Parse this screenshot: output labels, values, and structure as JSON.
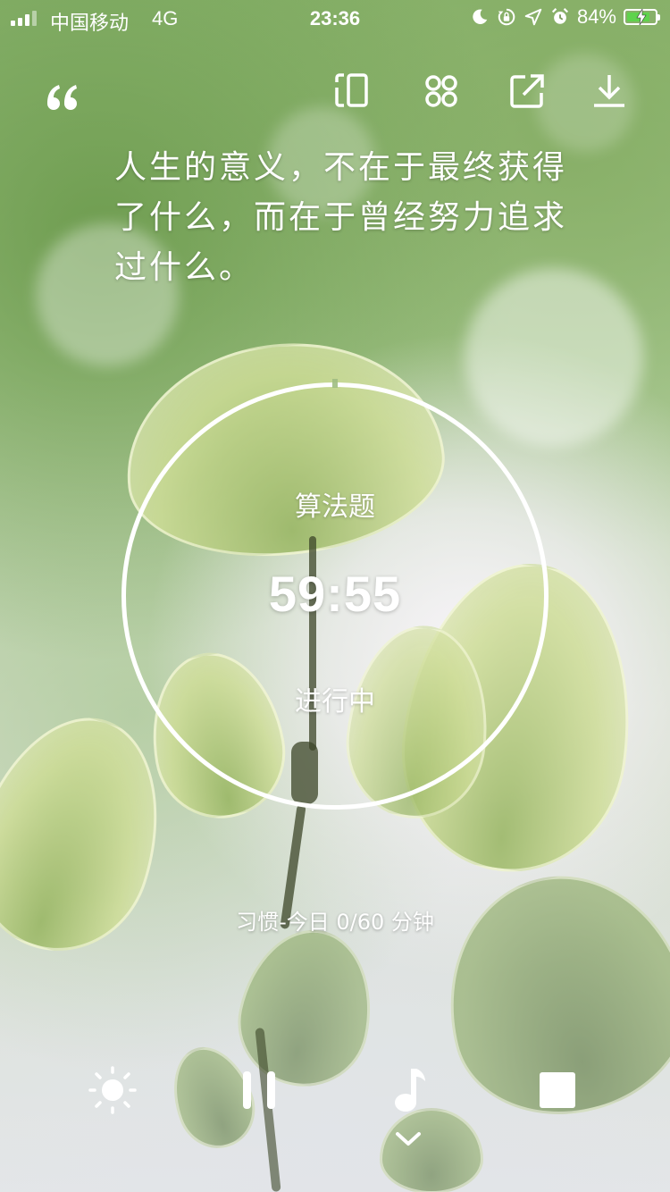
{
  "status_bar": {
    "carrier": "中国移动",
    "network": "4G",
    "time": "23:36",
    "battery_percent_text": "84%",
    "battery_level": 0.84,
    "icons": [
      "signal-icon",
      "moon-icon",
      "rotation-lock-icon",
      "location-icon",
      "alarm-icon",
      "battery-icon",
      "charging-bolt-icon"
    ]
  },
  "toolbar": {
    "icons": [
      "quote-icon",
      "flip-card-icon",
      "grid-menu-icon",
      "share-icon",
      "download-icon"
    ]
  },
  "quote": {
    "text": "人生的意义，不在于最终获得了什么，而在于曾经努力追求过什么。"
  },
  "timer": {
    "task_name": "算法题",
    "time_left": "59:55",
    "state": "进行中"
  },
  "habit": {
    "text": "习惯-今日 0/60 分钟"
  },
  "controls": {
    "icons": [
      "brightness-icon",
      "pause-icon",
      "music-note-icon",
      "stop-icon",
      "chevron-down-icon"
    ]
  },
  "colors": {
    "foreground": "#ffffff",
    "battery_fill": "#5fd34d",
    "background_green": "#a9c992"
  }
}
